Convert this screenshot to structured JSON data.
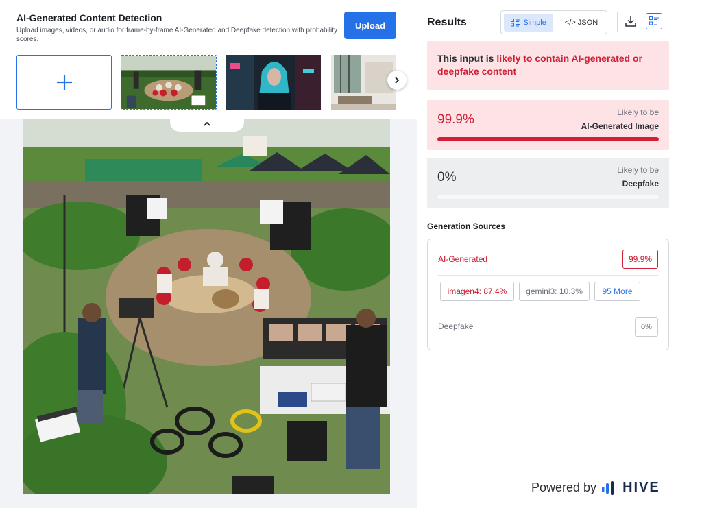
{
  "header": {
    "title": "AI-Generated Content Detection",
    "subtitle": "Upload images, videos, or audio for frame-by-frame AI-Generated and Deepfake detection with probability scores.",
    "upload_label": "Upload"
  },
  "icons": {
    "add": "plus-icon",
    "next": "chevron-right-icon",
    "collapse": "chevron-up-icon",
    "download": "download-icon",
    "view": "list-view-icon",
    "simple": "list-icon",
    "brand": "hive-logo"
  },
  "results": {
    "title": "Results",
    "view_simple": "Simple",
    "view_json": "</> JSON",
    "verdict_prefix": "This input is ",
    "verdict_highlight": "likely to contain AI-generated or deepfake content",
    "ai_score": {
      "value": "99.9%",
      "fraction": 0.999,
      "label_top": "Likely to be",
      "label_bottom": "AI-Generated Image"
    },
    "deepfake_score": {
      "value": "0%",
      "fraction": 0,
      "label_top": "Likely to be",
      "label_bottom": "Deepfake"
    }
  },
  "generation": {
    "title": "Generation Sources",
    "ai_label": "AI-Generated",
    "ai_value": "99.9%",
    "chips": [
      "imagen4: 87.4%",
      "gemini3: 10.3%",
      "95 More"
    ],
    "deepfake_label": "Deepfake",
    "deepfake_value": "0%"
  },
  "footer": {
    "powered_by": "Powered by",
    "brand": "HIVE"
  },
  "colors": {
    "accent": "#2571e8",
    "danger": "#d01f36",
    "danger_bg": "#fde3e6",
    "neutral_bg": "#eceef0"
  }
}
